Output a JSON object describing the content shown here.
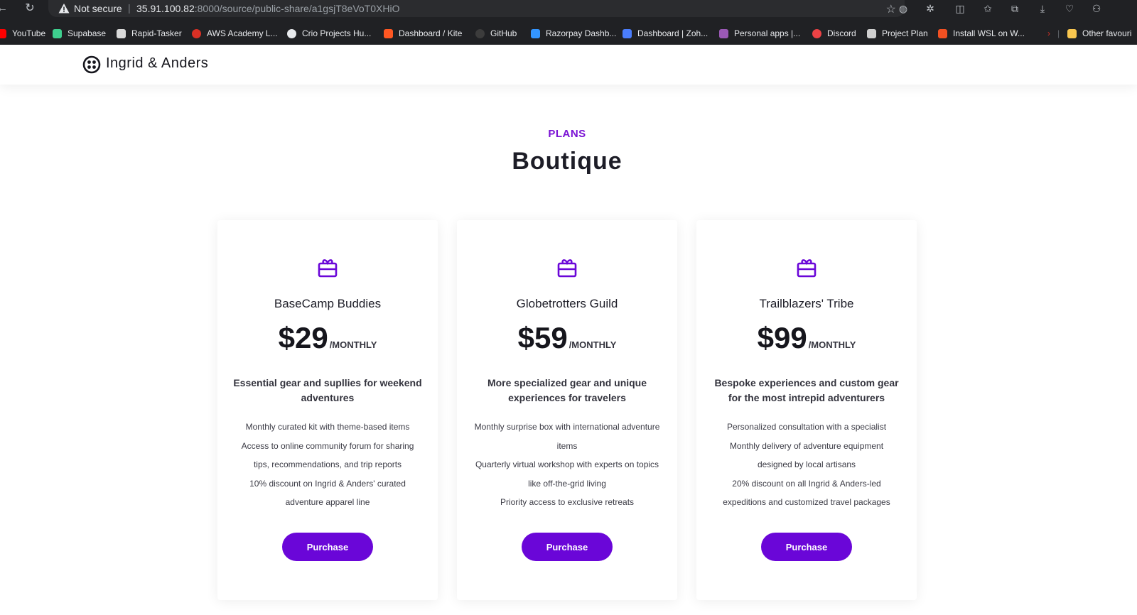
{
  "browser": {
    "security_label": "Not secure",
    "url_host": "35.91.100.82",
    "url_path": ":8000/source/public-share/a1gsjT8eVoT0XHiO",
    "bookmarks": [
      {
        "label": "YouTube",
        "color": "#ff0000"
      },
      {
        "label": "Supabase",
        "color": "#3ecf8e"
      },
      {
        "label": "Rapid-Tasker",
        "color": "#d9d9d9"
      },
      {
        "label": "AWS Academy L...",
        "color": "#d93025"
      },
      {
        "label": "Crio Projects Hu...",
        "color": "#e8eaed"
      },
      {
        "label": "Dashboard / Kite",
        "color": "#ff5722"
      },
      {
        "label": "GitHub",
        "color": "#3c3c3c"
      },
      {
        "label": "Razorpay Dashb...",
        "color": "#3395ff"
      },
      {
        "label": "Dashboard | Zoh...",
        "color": "#4a7dfc"
      },
      {
        "label": "Personal apps |...",
        "color": "#9b59b6"
      },
      {
        "label": "Discord",
        "color": "#ed4245"
      },
      {
        "label": "Project Plan",
        "color": "#cfcfcf"
      },
      {
        "label": "Install WSL on W...",
        "color": "#f25022"
      },
      {
        "label": "Other favouri",
        "color": "#f9c74f"
      }
    ]
  },
  "site": {
    "brand": "Ingrid & Anders",
    "eyebrow": "PLANS",
    "title": "Boutique",
    "accent_color": "#6a06d8"
  },
  "plans": [
    {
      "name": "BaseCamp Buddies",
      "price": "$29",
      "period": "/MONTHLY",
      "description": "Essential gear and supllies for weekend adventures",
      "features": [
        "Monthly curated kit with theme-based items",
        "Access to online community forum for sharing tips, recommendations, and trip reports",
        "10% discount on Ingrid & Anders' curated adventure apparel line"
      ],
      "button": "Purchase"
    },
    {
      "name": "Globetrotters Guild",
      "price": "$59",
      "period": "/MONTHLY",
      "description": "More specialized gear and unique experiences for travelers",
      "features": [
        "Monthly surprise box with international adventure items",
        "Quarterly virtual workshop with experts on topics like off-the-grid living",
        "Priority access to exclusive retreats"
      ],
      "button": "Purchase"
    },
    {
      "name": "Trailblazers' Tribe",
      "price": "$99",
      "period": "/MONTHLY",
      "description": "Bespoke experiences and custom gear for the most intrepid adventurers",
      "features": [
        "Personalized consultation with a specialist",
        "Monthly delivery of adventure equipment designed by local artisans",
        "20% discount on all Ingrid & Anders-led expeditions and customized travel packages"
      ],
      "button": "Purchase"
    }
  ]
}
